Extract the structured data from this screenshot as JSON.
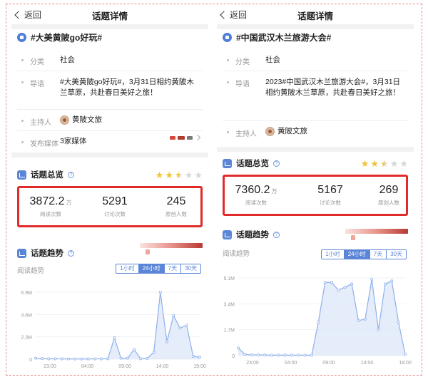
{
  "common": {
    "back_label": "返回",
    "nav_title": "话题详情",
    "category_label": "分类",
    "intro_label": "导语",
    "host_label": "主持人",
    "media_label": "发布媒体",
    "overview_title": "话题总览",
    "trend_title": "话题趋势",
    "read_trend_label": "阅读趋势",
    "reads_caption": "阅读次数",
    "discuss_caption": "讨论次数",
    "original_caption": "原创人数",
    "unit_wan": "万",
    "ranges": [
      "1小时",
      "24小时",
      "7天",
      "30天"
    ],
    "active_range": "24小时",
    "colors": {
      "highlight_border": "#e12b2b",
      "accent": "#5b86d8",
      "star": "#f1c232",
      "line": "#8fb0ec"
    }
  },
  "left": {
    "topic_title": "#大美黄陂go好玩#",
    "category": "社会",
    "intro": "#大美黄陂go好玩#，3月31日相约黄陂木兰草原，共赴春日美好之旅！",
    "host": "黄陂文旅",
    "media": "3家媒体",
    "rating": 2.5,
    "reads": "3872.2",
    "discussions": "5291",
    "originals": "245",
    "read_trend_label": "阅读趋势",
    "chart_data": {
      "type": "area",
      "x_ticks": [
        "23:00",
        "04:00",
        "09:00",
        "14:00",
        "19:00"
      ],
      "y_ticks": [
        "0",
        "2.3M",
        "4.6M",
        "6.9M"
      ],
      "ylim": [
        0,
        6900000
      ],
      "values": [
        100000,
        60000,
        40000,
        40000,
        40000,
        30000,
        30000,
        30000,
        30000,
        40000,
        40000,
        50000,
        2200000,
        100000,
        100000,
        1000000,
        50000,
        80000,
        700000,
        6900000,
        1800000,
        4500000,
        3200000,
        3500000,
        300000,
        200000
      ]
    }
  },
  "right": {
    "topic_title": "#中国武汉木兰旅游大会#",
    "category": "社会",
    "intro": "2023#中国武汉木兰旅游大会#，3月31日相约黄陂木兰草原，共赴春日美好之旅！",
    "host": "黄陂文旅",
    "rating": 2.5,
    "reads": "7360.2",
    "discussions": "5167",
    "originals": "269",
    "read_trend_label": "阅读趋势",
    "chart_data": {
      "type": "area",
      "x_ticks": [
        "23:00",
        "04:00",
        "09:00",
        "14:00",
        "19:00"
      ],
      "y_ticks": [
        "0",
        "1.7M",
        "3.4M",
        "5.1M"
      ],
      "ylim": [
        0,
        5100000
      ],
      "values": [
        500000,
        80000,
        50000,
        50000,
        40000,
        30000,
        30000,
        30000,
        30000,
        30000,
        30000,
        30000,
        2200000,
        4800000,
        4800000,
        4300000,
        4500000,
        4700000,
        2300000,
        2400000,
        5000000,
        1700000,
        4700000,
        4900000,
        2200000,
        100000
      ]
    }
  }
}
